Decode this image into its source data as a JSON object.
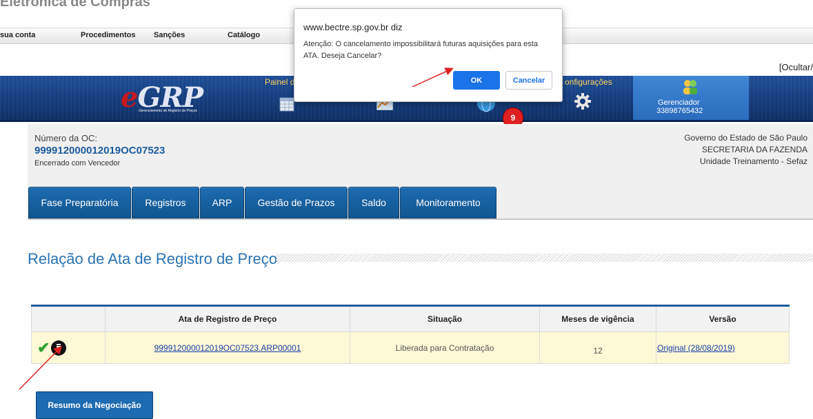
{
  "top": {
    "cut_title": "Eletrônica de Compras",
    "ocultar": "[Ocultar/"
  },
  "menu": {
    "items": [
      "sua conta",
      "Procedimentos",
      "Sanções",
      "Catálogo"
    ]
  },
  "banner": {
    "logo_e": "e",
    "logo_rest": "GRP",
    "logo_sub": "Gerenciamento de Registro de Preços",
    "painel_label": "Painel d",
    "config_label": "onfigurações",
    "gerenciador_label": "Gerenciador",
    "gerenciador_number": "33898765432",
    "notification_count": "9"
  },
  "oc": {
    "label": "Número da OC:",
    "number": "999912000012019OC07523",
    "status": "Encerrado com Vencedor",
    "gov_line1": "Governo do Estado de São Paulo",
    "gov_line2": "SECRETARIA DA FAZENDA",
    "gov_line3": "Unidade Treinamento - Sefaz"
  },
  "tabs": [
    "Fase Preparatória",
    "Registros",
    "ARP",
    "Gestão de Prazos",
    "Saldo",
    "Monitoramento"
  ],
  "section_title": "Relação de Ata de Registro de Preço",
  "table": {
    "headers": [
      "",
      "Ata de Registro de Preço",
      "Situação",
      "Meses de vigência",
      "Versão"
    ],
    "rows": [
      {
        "ata": "999912000012019OC07523.ARP00001",
        "situacao": "Liberada para Contratação",
        "meses": "12",
        "versao": "Original (28/08/2019)"
      }
    ]
  },
  "resumo_button": "Resumo da Negociação",
  "dialog": {
    "title": "www.bectre.sp.gov.br diz",
    "message": "Atenção: O cancelamento impossibilitará futuras aquisições para esta ATA. Deseja Cancelar?",
    "ok": "OK",
    "cancel": "Cancelar"
  },
  "colors": {
    "banner": "#143b7a",
    "tab": "#1d6bb0",
    "accent": "#1c5a9e",
    "row_bg": "#fdf8d6",
    "dialog_ok": "#1a73e8",
    "arrow": "#e02020"
  },
  "icons": [
    "check-icon",
    "trash-icon",
    "calendar-icon",
    "chart-icon",
    "globe-icon",
    "gear-icon",
    "users-icon"
  ]
}
